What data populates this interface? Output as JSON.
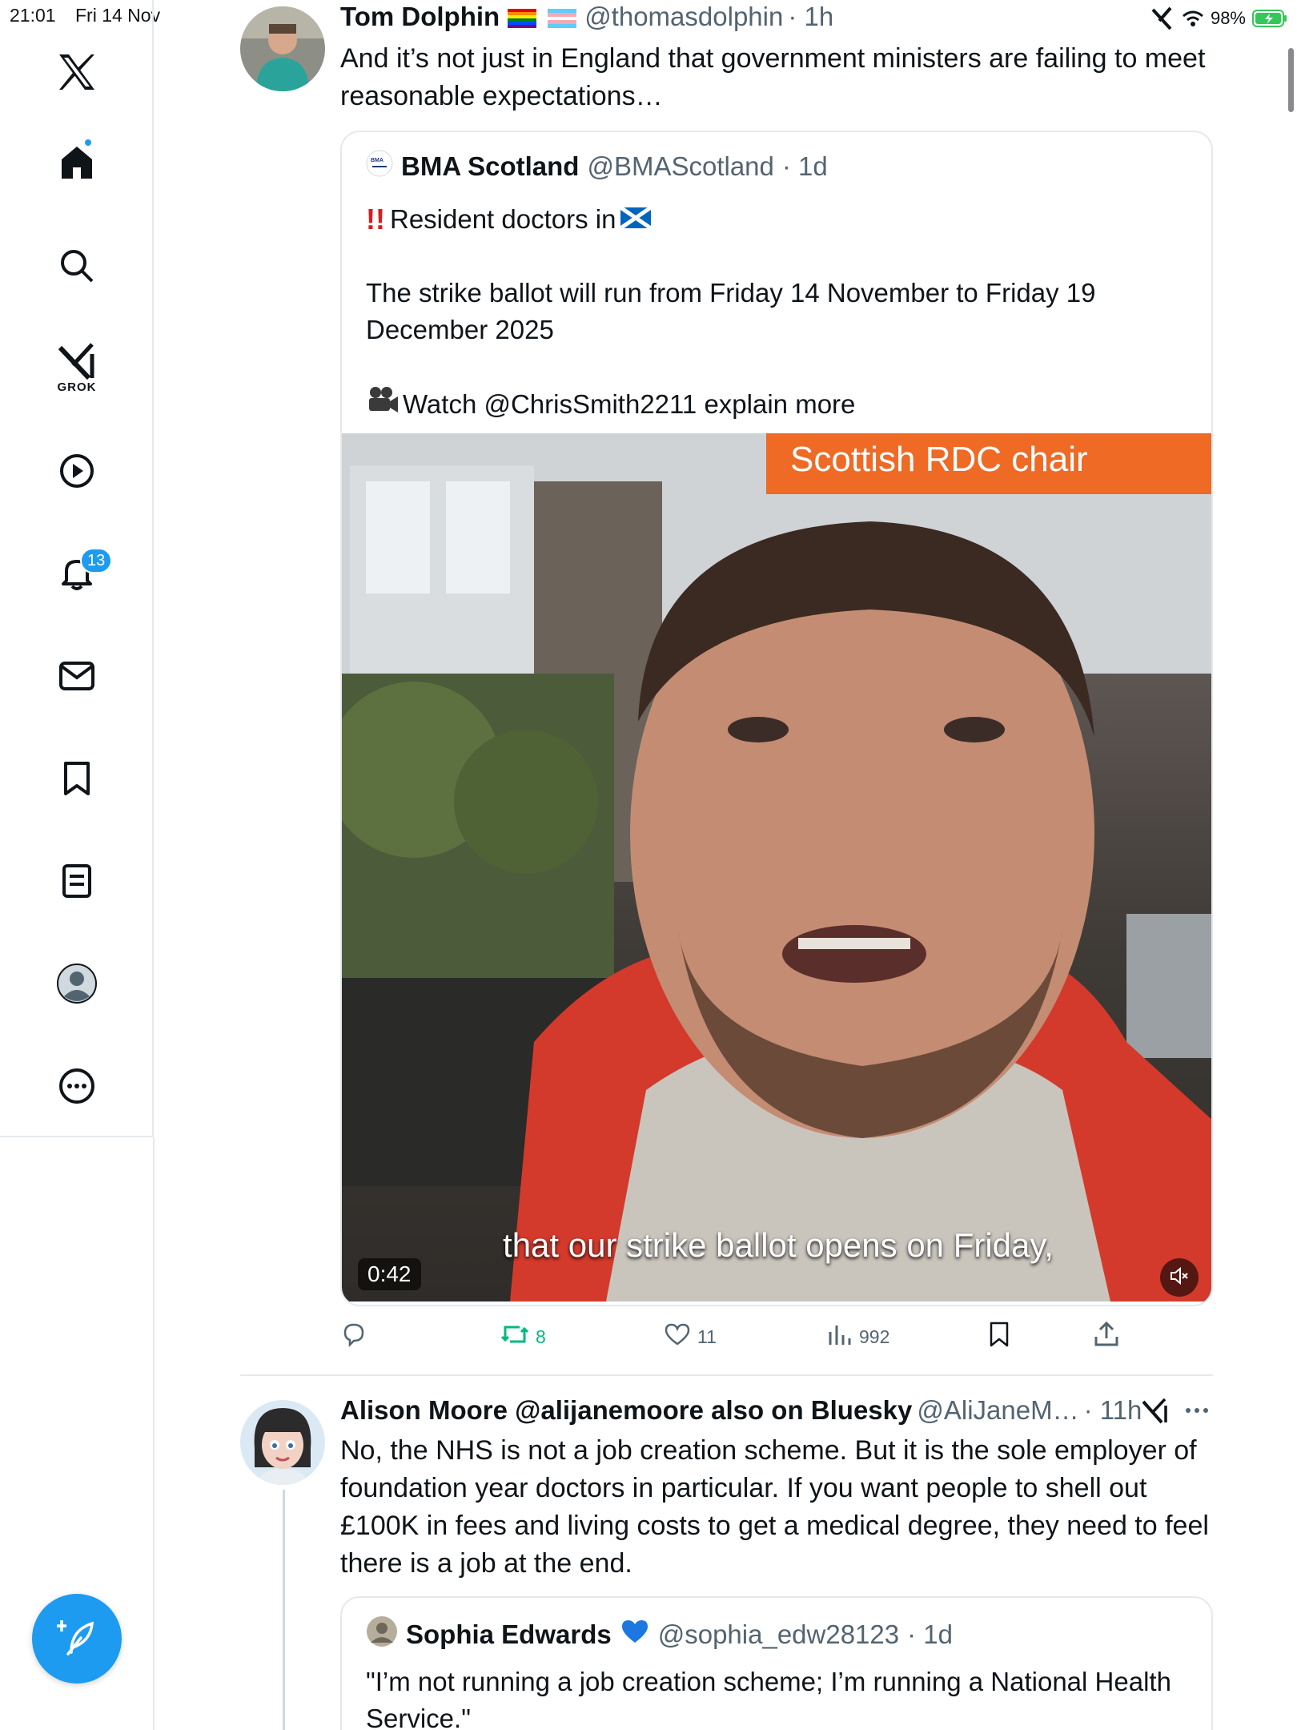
{
  "status": {
    "time": "21:01",
    "date": "Fri 14 Nov",
    "battery": "98%"
  },
  "sidebar": {
    "items": [
      {
        "name": "x-logo-icon"
      },
      {
        "name": "home-icon"
      },
      {
        "name": "search-icon"
      },
      {
        "name": "grok-icon",
        "label": "GROK"
      },
      {
        "name": "play-icon"
      },
      {
        "name": "bell-icon",
        "badge": "13"
      },
      {
        "name": "mail-icon"
      },
      {
        "name": "bookmark-icon"
      },
      {
        "name": "lists-icon"
      },
      {
        "name": "profile-icon"
      },
      {
        "name": "more-icon"
      }
    ],
    "accent": "#1d9bf0"
  },
  "tweet1": {
    "name": "Tom Dolphin",
    "handle": "@thomasdolphin",
    "time": "· 1h",
    "text": "And it’s not just in England that government ministers are failing to meet reasonable expectations…",
    "quote": {
      "name": "BMA Scotland",
      "handle": "@BMAScotland",
      "time": "· 1d",
      "line1": "Resident doctors in",
      "line2": "The strike ballot will run from Friday 14 November to Friday 19 December 2025",
      "line3": "Watch @ChrisSmith2211 explain more",
      "video": {
        "banner": "Scottish RDC chair",
        "subtitle": "that our strike ballot opens on Friday,",
        "duration": "0:42"
      }
    },
    "actions": {
      "reposts": "8",
      "likes": "11",
      "views": "992"
    }
  },
  "tweet2": {
    "name": "Alison Moore @alijanemoore also on Bluesky",
    "handle": "@AliJaneM…",
    "time": "· 11h",
    "text": "No, the NHS is not a job creation scheme. But it is the sole employer of foundation year doctors in particular. If you want people to shell out £100K in fees and living costs to get a medical degree, they need to feel there is a job at the end.",
    "quote": {
      "name": "Sophia Edwards",
      "handle": "@sophia_edw28123",
      "time": "· 1d",
      "text": "\"I’m not running a job creation scheme; I’m running a National Health Service.\""
    }
  }
}
